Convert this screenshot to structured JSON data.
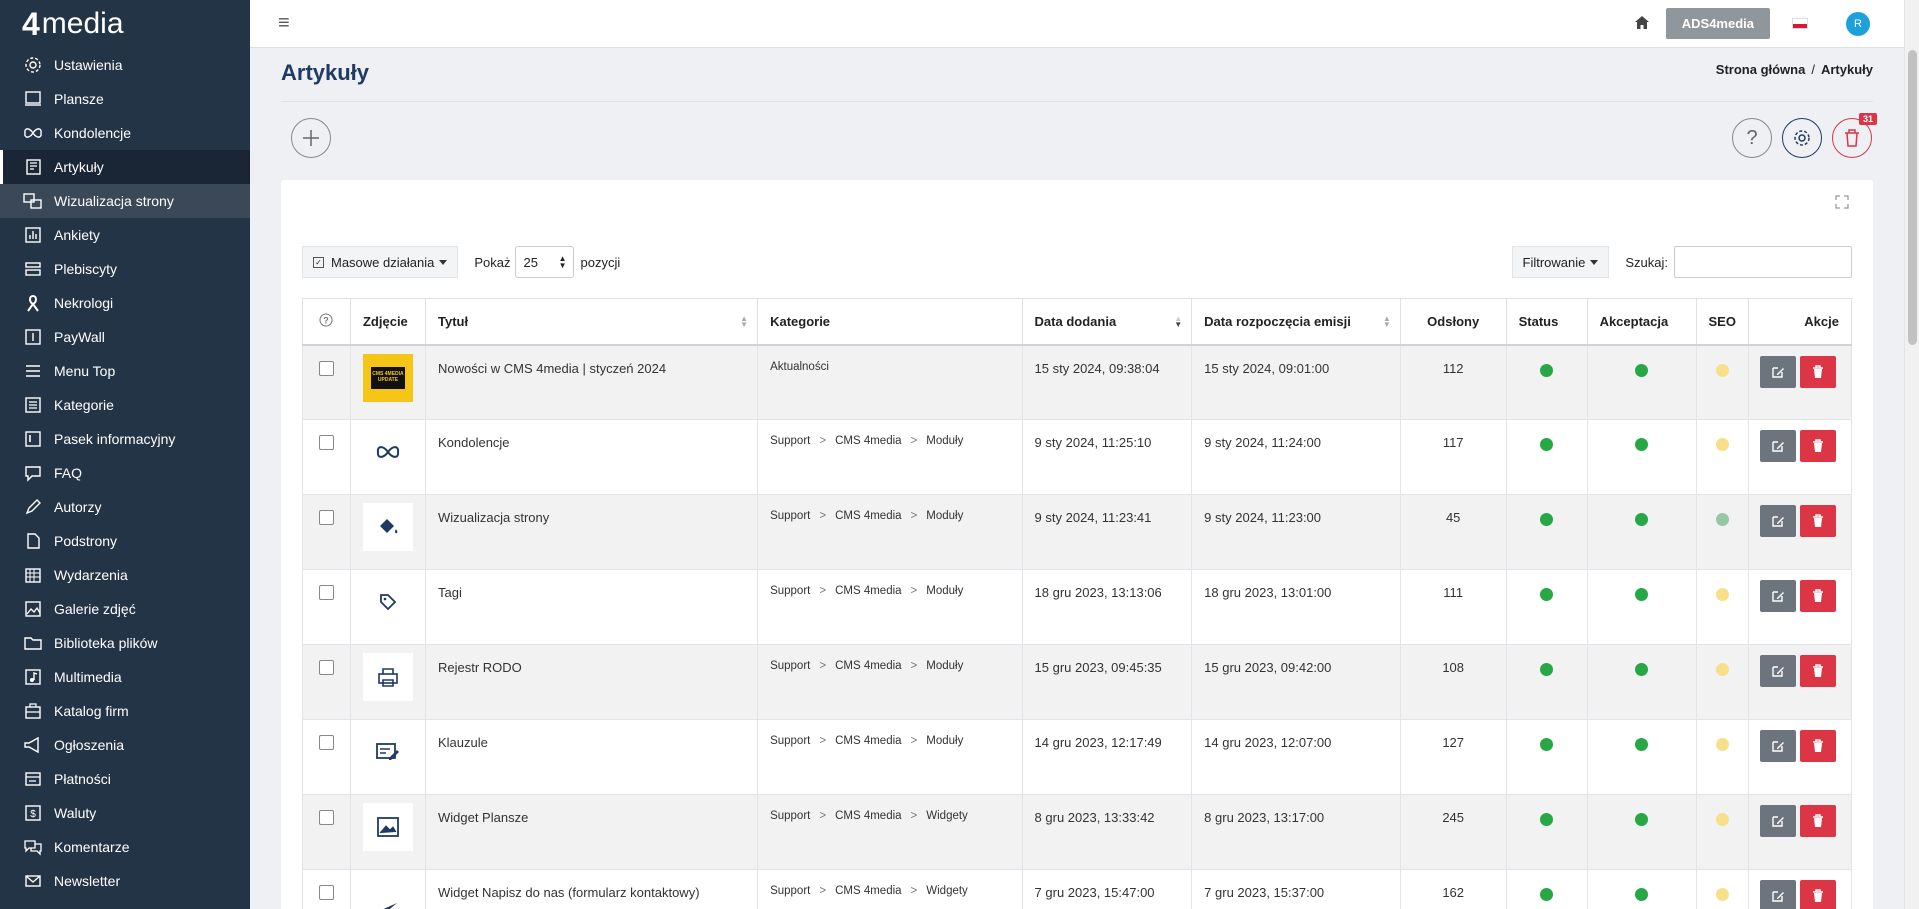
{
  "brand": {
    "num": "4",
    "name": "media"
  },
  "sidebar": {
    "items": [
      {
        "label": "Ustawienia",
        "icon": "gear-icon"
      },
      {
        "label": "Plansze",
        "icon": "monitor-icon"
      },
      {
        "label": "Kondolencje",
        "icon": "ribbon-icon"
      },
      {
        "label": "Artykuły",
        "icon": "newspaper-icon"
      },
      {
        "label": "Wizualizacja strony",
        "icon": "layout-icon"
      },
      {
        "label": "Ankiety",
        "icon": "poll-icon"
      },
      {
        "label": "Plebiscyty",
        "icon": "list-icon"
      },
      {
        "label": "Nekrologi",
        "icon": "mourning-ribbon-icon"
      },
      {
        "label": "PayWall",
        "icon": "paywall-icon"
      },
      {
        "label": "Menu Top",
        "icon": "menu-icon"
      },
      {
        "label": "Kategorie",
        "icon": "category-icon"
      },
      {
        "label": "Pasek informacyjny",
        "icon": "info-bar-icon"
      },
      {
        "label": "FAQ",
        "icon": "faq-icon"
      },
      {
        "label": "Autorzy",
        "icon": "author-icon"
      },
      {
        "label": "Podstrony",
        "icon": "pages-icon"
      },
      {
        "label": "Wydarzenia",
        "icon": "calendar-icon"
      },
      {
        "label": "Galerie zdjęć",
        "icon": "gallery-icon"
      },
      {
        "label": "Biblioteka plików",
        "icon": "folder-icon"
      },
      {
        "label": "Multimedia",
        "icon": "music-icon"
      },
      {
        "label": "Katalog firm",
        "icon": "briefcase-icon"
      },
      {
        "label": "Ogłoszenia",
        "icon": "megaphone-icon"
      },
      {
        "label": "Płatności",
        "icon": "payment-icon"
      },
      {
        "label": "Waluty",
        "icon": "currency-icon"
      },
      {
        "label": "Komentarze",
        "icon": "comments-icon"
      },
      {
        "label": "Newsletter",
        "icon": "envelope-icon"
      }
    ],
    "active_index": 3,
    "hover_index": 4
  },
  "topbar": {
    "ads_button": "ADS4media",
    "avatar_letter": "R"
  },
  "page": {
    "title": "Artykuły",
    "breadcrumb": {
      "home": "Strona główna",
      "current": "Artykuły"
    },
    "trash_count": "31"
  },
  "toolbar": {
    "mass_actions": "Masowe działania",
    "show_label": "Pokaż",
    "page_size": "25",
    "positions_label": "pozycji",
    "filter_label": "Filtrowanie",
    "search_label": "Szukaj:",
    "search_value": ""
  },
  "table": {
    "headers": {
      "photo": "Zdjęcie",
      "title": "Tytuł",
      "categories": "Kategorie",
      "date_added": "Data dodania",
      "emission_start": "Data rozpoczęcia emisji",
      "views": "Odsłony",
      "status": "Status",
      "acceptance": "Akceptacja",
      "seo": "SEO",
      "actions": "Akcje"
    },
    "rows": [
      {
        "title": "Nowości w CMS 4media | styczeń 2024",
        "thumb": "cms-update-thumbnail",
        "categories": [
          "Aktualności"
        ],
        "date_added": "15 sty 2024, 09:38:04",
        "emission": "15 sty 2024, 09:01:00",
        "views": "112",
        "status": "green",
        "acceptance": "green",
        "seo": "yellow"
      },
      {
        "title": "Kondolencje",
        "thumb": "ribbon-icon",
        "categories": [
          "Support",
          "CMS 4media",
          "Moduły"
        ],
        "date_added": "9 sty 2024, 11:25:10",
        "emission": "9 sty 2024, 11:24:00",
        "views": "117",
        "status": "green",
        "acceptance": "green",
        "seo": "yellow"
      },
      {
        "title": "Wizualizacja strony",
        "thumb": "paint-bucket-icon",
        "categories": [
          "Support",
          "CMS 4media",
          "Moduły"
        ],
        "date_added": "9 sty 2024, 11:23:41",
        "emission": "9 sty 2024, 11:23:00",
        "views": "45",
        "status": "green",
        "acceptance": "green",
        "seo": "lightgreen"
      },
      {
        "title": "Tagi",
        "thumb": "tag-icon",
        "categories": [
          "Support",
          "CMS 4media",
          "Moduły"
        ],
        "date_added": "18 gru 2023, 13:13:06",
        "emission": "18 gru 2023, 13:01:00",
        "views": "111",
        "status": "green",
        "acceptance": "green",
        "seo": "yellow"
      },
      {
        "title": "Rejestr RODO",
        "thumb": "printer-icon",
        "categories": [
          "Support",
          "CMS 4media",
          "Moduły"
        ],
        "date_added": "15 gru 2023, 09:45:35",
        "emission": "15 gru 2023, 09:42:00",
        "views": "108",
        "status": "green",
        "acceptance": "green",
        "seo": "yellow"
      },
      {
        "title": "Klauzule",
        "thumb": "document-edit-icon",
        "categories": [
          "Support",
          "CMS 4media",
          "Moduły"
        ],
        "date_added": "14 gru 2023, 12:17:49",
        "emission": "14 gru 2023, 12:07:00",
        "views": "127",
        "status": "green",
        "acceptance": "green",
        "seo": "yellow"
      },
      {
        "title": "Widget Plansze",
        "thumb": "image-icon",
        "categories": [
          "Support",
          "CMS 4media",
          "Widgety"
        ],
        "date_added": "8 gru 2023, 13:33:42",
        "emission": "8 gru 2023, 13:17:00",
        "views": "245",
        "status": "green",
        "acceptance": "green",
        "seo": "yellow"
      },
      {
        "title": "Widget Napisz do nas (formularz kontaktowy)",
        "thumb": "send-icon",
        "categories": [
          "Support",
          "CMS 4media",
          "Widgety"
        ],
        "date_added": "7 gru 2023, 15:47:00",
        "emission": "7 gru 2023, 15:37:00",
        "views": "162",
        "status": "green",
        "acceptance": "green",
        "seo": "yellow"
      }
    ]
  },
  "colors": {
    "sidebar_bg": "#243447",
    "title": "#1f3a63",
    "green": "#28a745",
    "seo_yellow": "#f8e08a",
    "delete": "#dc3545",
    "edit": "#6c757d"
  }
}
